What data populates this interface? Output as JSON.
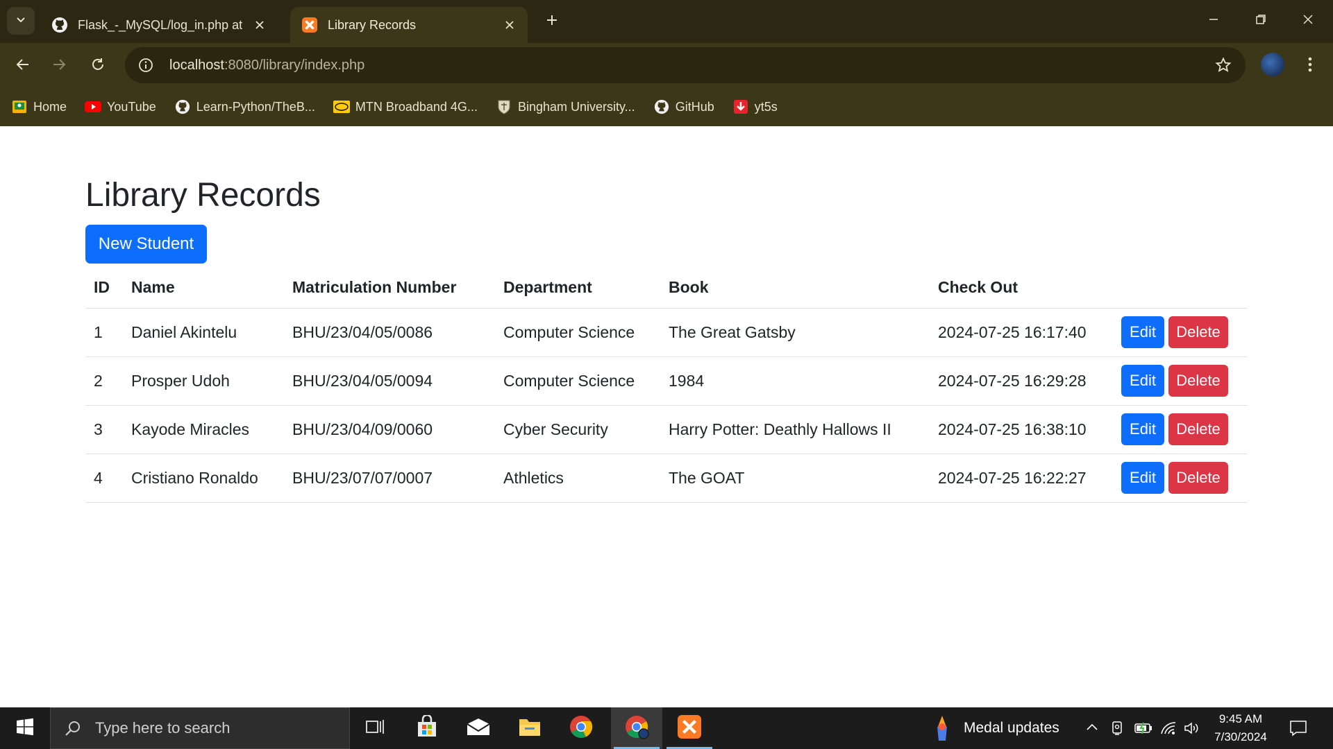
{
  "browser": {
    "tabs": [
      {
        "title": "Flask_-_MySQL/log_in.php at m",
        "icon": "github-icon",
        "active": false
      },
      {
        "title": "Library Records",
        "icon": "xampp-icon",
        "active": true
      }
    ],
    "address": {
      "host": "localhost",
      "path": ":8080/library/index.php"
    },
    "bookmarks": [
      {
        "label": "Home",
        "icon": "classroom-icon"
      },
      {
        "label": "YouTube",
        "icon": "youtube-icon"
      },
      {
        "label": "Learn-Python/TheB...",
        "icon": "github-icon"
      },
      {
        "label": "MTN Broadband 4G...",
        "icon": "mtn-icon"
      },
      {
        "label": "Bingham University...",
        "icon": "university-crest-icon"
      },
      {
        "label": "GitHub",
        "icon": "github-icon"
      },
      {
        "label": "yt5s",
        "icon": "download-icon"
      }
    ]
  },
  "page": {
    "title": "Library Records",
    "new_button": "New Student",
    "columns": [
      "ID",
      "Name",
      "Matriculation Number",
      "Department",
      "Book",
      "Check Out"
    ],
    "edit_label": "Edit",
    "delete_label": "Delete",
    "rows": [
      {
        "id": "1",
        "name": "Daniel Akintelu",
        "matric": "BHU/23/04/05/0086",
        "department": "Computer Science",
        "book": "The Great Gatsby",
        "checkout": "2024-07-25 16:17:40"
      },
      {
        "id": "2",
        "name": "Prosper Udoh",
        "matric": "BHU/23/04/05/0094",
        "department": "Computer Science",
        "book": "1984",
        "checkout": "2024-07-25 16:29:28"
      },
      {
        "id": "3",
        "name": "Kayode Miracles",
        "matric": "BHU/23/04/09/0060",
        "department": "Cyber Security",
        "book": "Harry Potter: Deathly Hallows II",
        "checkout": "2024-07-25 16:38:10"
      },
      {
        "id": "4",
        "name": "Cristiano Ronaldo",
        "matric": "BHU/23/07/07/0007",
        "department": "Athletics",
        "book": "The GOAT",
        "checkout": "2024-07-25 16:22:27"
      }
    ]
  },
  "taskbar": {
    "search_placeholder": "Type here to search",
    "widget": "Medal updates",
    "time": "9:45 AM",
    "date": "7/30/2024"
  },
  "colors": {
    "primary": "#0d6efd",
    "danger": "#dc3545",
    "chrome_frame": "#2b2712",
    "chrome_toolbar": "#3c3719"
  }
}
